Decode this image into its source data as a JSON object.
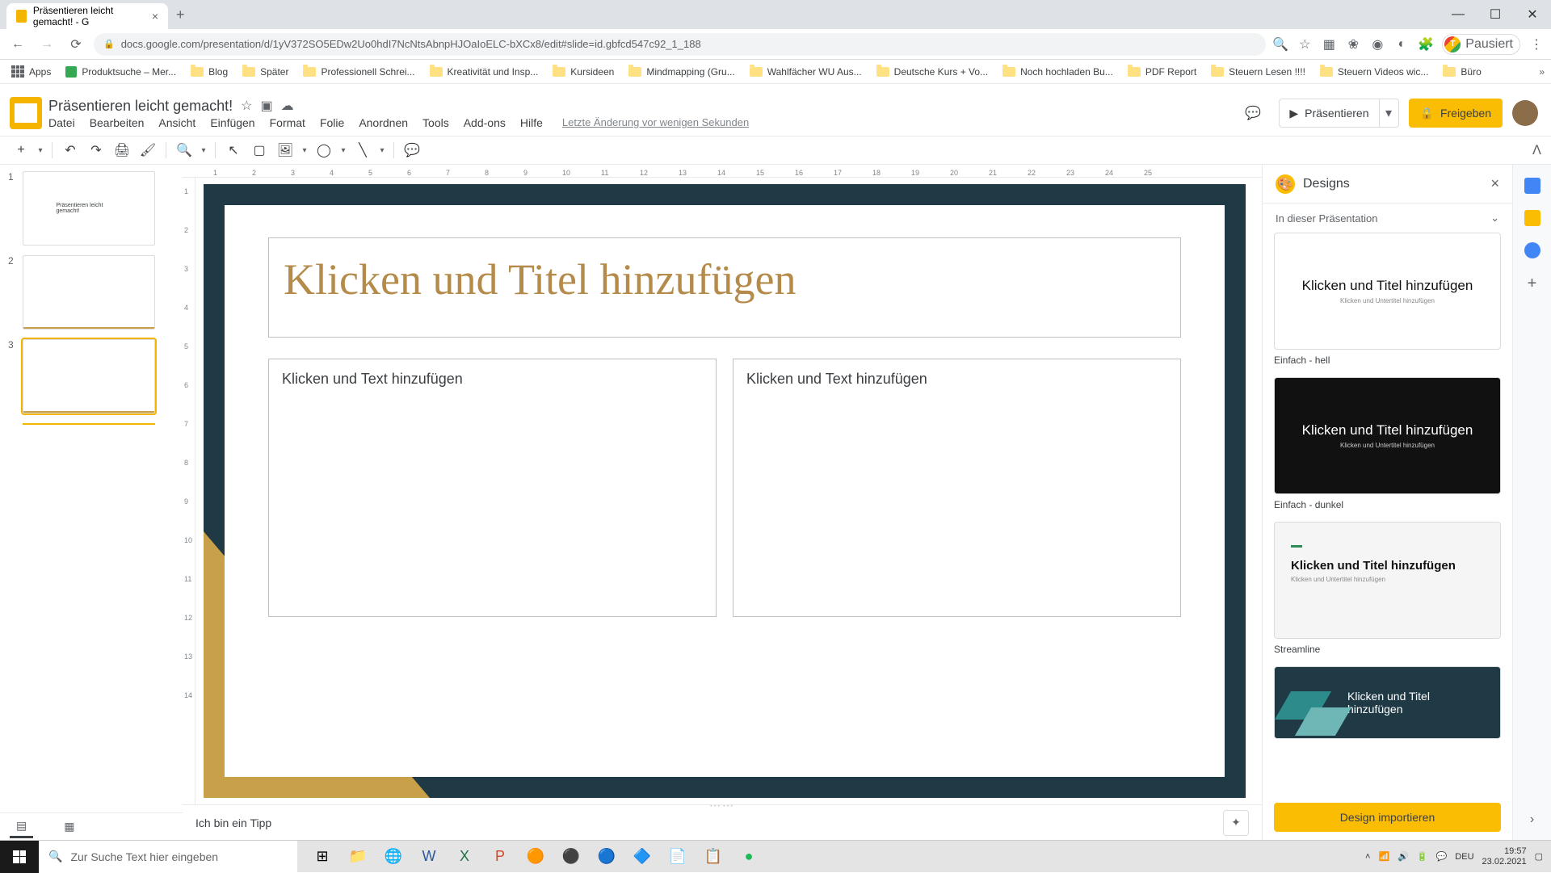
{
  "browser": {
    "tab_title": "Präsentieren leicht gemacht! - G",
    "url": "docs.google.com/presentation/d/1yV372SO5EDw2Uo0hdI7NcNtsAbnpHJOaIoELC-bXCx8/edit#slide=id.gbfcd547c92_1_188",
    "pause_label": "Pausiert"
  },
  "bookmarks": [
    "Apps",
    "Produktsuche – Mer...",
    "Blog",
    "Später",
    "Professionell Schrei...",
    "Kreativität und Insp...",
    "Kursideen",
    "Mindmapping  (Gru...",
    "Wahlfächer WU Aus...",
    "Deutsche Kurs + Vo...",
    "Noch hochladen Bu...",
    "PDF Report",
    "Steuern Lesen !!!!",
    "Steuern Videos wic...",
    "Büro"
  ],
  "doc": {
    "title": "Präsentieren leicht gemacht!",
    "menus": [
      "Datei",
      "Bearbeiten",
      "Ansicht",
      "Einfügen",
      "Format",
      "Folie",
      "Anordnen",
      "Tools",
      "Add-ons",
      "Hilfe"
    ],
    "last_edit": "Letzte Änderung vor wenigen Sekunden",
    "present": "Präsentieren",
    "share": "Freigeben"
  },
  "slide": {
    "title": "Klicken und Titel hinzufügen",
    "body_left": "Klicken und Text hinzufügen",
    "body_right": "Klicken und Text hinzufügen",
    "notes": "Ich bin ein Tipp",
    "thumb1_text": "Präsentieren leicht gemacht!"
  },
  "thumbs": [
    "1",
    "2",
    "3"
  ],
  "designs": {
    "title": "Designs",
    "section": "In dieser Präsentation",
    "cards": [
      {
        "title": "Klicken und Titel hinzufügen",
        "sub": "Klicken und Untertitel hinzufügen",
        "label": "Einfach - hell"
      },
      {
        "title": "Klicken und Titel hinzufügen",
        "sub": "Klicken und Untertitel hinzufügen",
        "label": "Einfach - dunkel"
      },
      {
        "title": "Klicken und Titel hinzufügen",
        "sub": "Klicken und Untertitel hinzufügen",
        "label": "Streamline"
      },
      {
        "title": "Klicken und Titel hinzufügen",
        "sub": "",
        "label": ""
      }
    ],
    "import": "Design importieren"
  },
  "taskbar": {
    "search_placeholder": "Zur Suche Text hier eingeben",
    "lang": "DEU",
    "time": "19:57",
    "date": "23.02.2021"
  },
  "ruler_h": [
    "1",
    "2",
    "3",
    "4",
    "5",
    "6",
    "7",
    "8",
    "9",
    "10",
    "11",
    "12",
    "13",
    "14",
    "15",
    "16",
    "17",
    "18",
    "19",
    "20",
    "21",
    "22",
    "23",
    "24",
    "25"
  ],
  "ruler_v": [
    "1",
    "2",
    "3",
    "4",
    "5",
    "6",
    "7",
    "8",
    "9",
    "10",
    "11",
    "12",
    "13",
    "14"
  ]
}
